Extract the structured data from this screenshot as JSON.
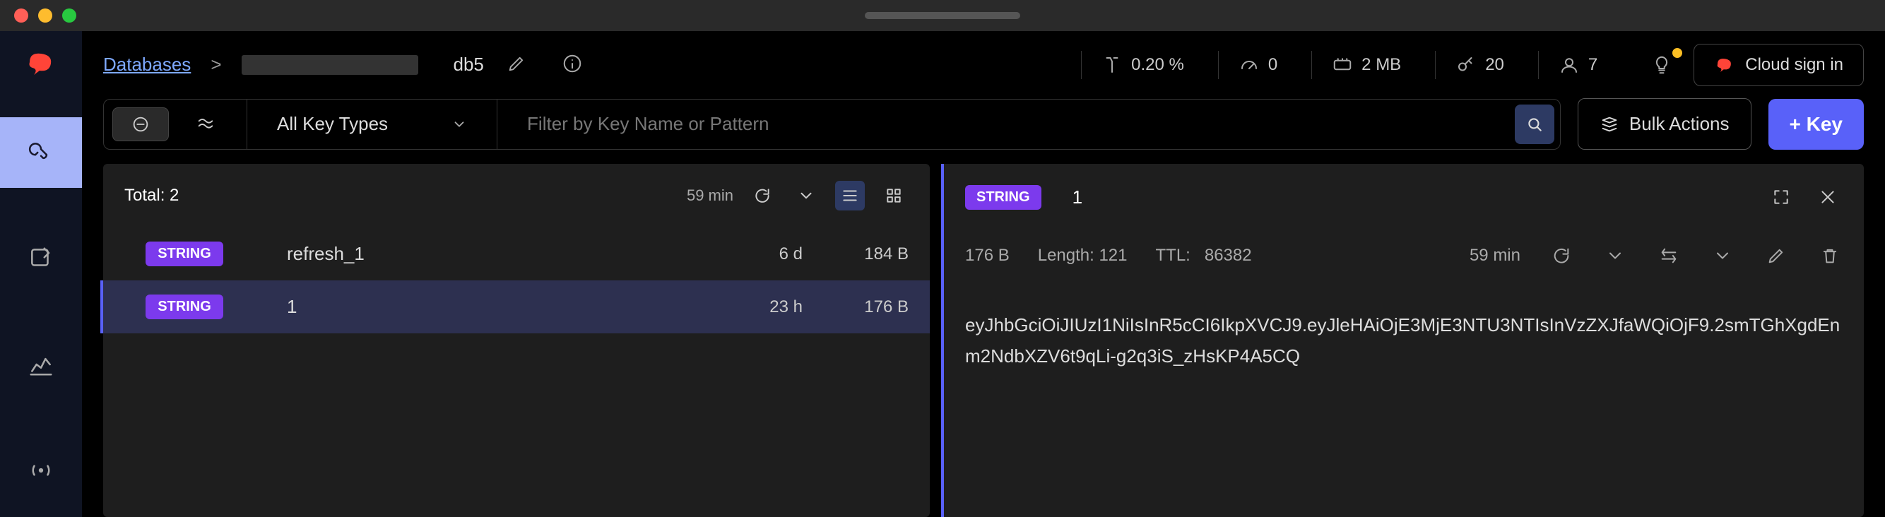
{
  "breadcrumb": {
    "root": "Databases",
    "sep": ">",
    "db": "db5"
  },
  "stats": {
    "cpu": "0.20 %",
    "latency": "0",
    "mem": "2 MB",
    "keys": "20",
    "clients": "7"
  },
  "cloud_signin": "Cloud sign in",
  "filters": {
    "key_types_label": "All Key Types",
    "filter_placeholder": "Filter by Key Name or Pattern",
    "bulk_label": "Bulk Actions",
    "add_key_label": "+ Key"
  },
  "list": {
    "total_label": "Total: 2",
    "refresh_time": "59 min",
    "rows": [
      {
        "type": "STRING",
        "name": "refresh_1",
        "ttl": "6 d",
        "size": "184 B"
      },
      {
        "type": "STRING",
        "name": "1",
        "ttl": "23 h",
        "size": "176 B"
      }
    ]
  },
  "detail": {
    "type": "STRING",
    "key": "1",
    "size": "176 B",
    "length_label": "Length: 121",
    "ttl_label": "TTL:",
    "ttl_value": "86382",
    "refresh_time": "59 min",
    "value": "eyJhbGciOiJIUzI1NiIsInR5cCI6IkpXVCJ9.eyJleHAiOjE3MjE3NTU3NTIsInVzZXJfaWQiOjF9.2smTGhXgdEnm2NdbXZV6t9qLi-g2q3iS_zHsKP4A5CQ"
  }
}
